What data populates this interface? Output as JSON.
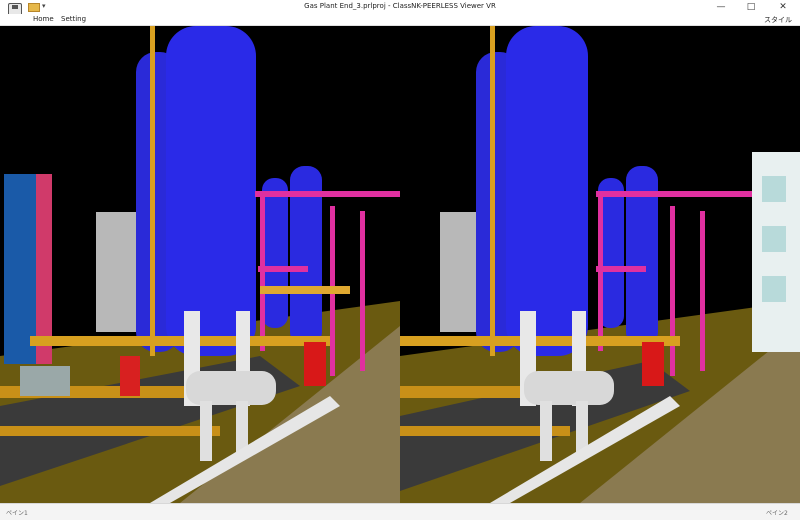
{
  "window": {
    "title": "Gas Plant End_3.prlproj - ClassNK-PEERLESS Viewer VR",
    "minimize": "—",
    "maximize": "□",
    "close": "✕"
  },
  "toolbar": {
    "save_icon": "save-icon",
    "open_icon": "folder-open-icon",
    "dropdown": "▾"
  },
  "menu": {
    "home": "Home",
    "setting": "Setting",
    "style": "スタイル"
  },
  "viewport": {
    "background": "#000000",
    "panes": [
      {
        "name": "pane-left"
      },
      {
        "name": "pane-right"
      }
    ]
  },
  "status": {
    "left": "ペイン1",
    "right": "ペイン2"
  }
}
